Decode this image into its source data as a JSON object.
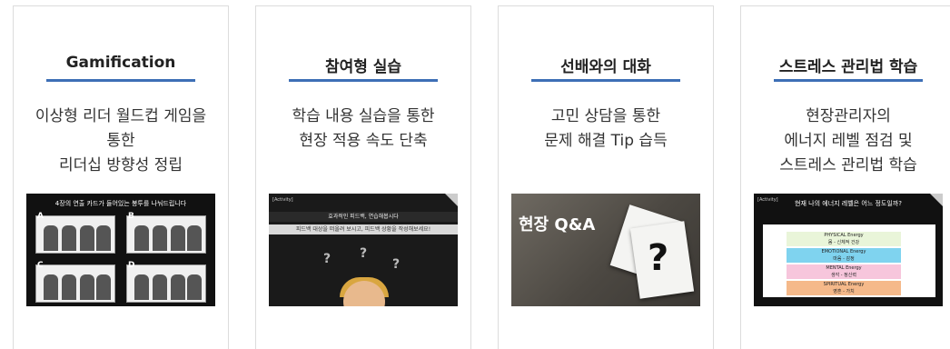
{
  "cards": [
    {
      "title": "Gamification",
      "desc": [
        "이상형 리더 월드컵 게임을",
        "통한",
        "리더십 방향성 정립"
      ],
      "thumb": {
        "header": "4장의 연출 카드가 들어있는 봉투를 나눠드립니다",
        "labels": [
          "A",
          "B",
          "C",
          "D"
        ]
      }
    },
    {
      "title": "참여형 실습",
      "desc": [
        "학습 내용 실습을 통한",
        "현장 적용 속도 단축"
      ],
      "thumb": {
        "tag": "[Activity]",
        "line1": "효과적인 피드백, 연습해봅시다",
        "line2": "피드백 대상을 떠올려 보시고, 피드백 상황을 작성해보세요!"
      }
    },
    {
      "title": "선배와의 대화",
      "desc": [
        "고민 상담을 통한",
        "문제 해결 Tip 습득"
      ],
      "thumb": {
        "caption": "현장 Q&A",
        "mark": "?"
      }
    },
    {
      "title": "스트레스 관리법 학습",
      "desc": [
        "현장관리자의",
        "에너지 레벨 점검 및",
        "스트레스 관리법 학습"
      ],
      "thumb": {
        "tag": "[Activity]",
        "header": "현재 나의 에너지 레벨은 어느 정도일까?",
        "rows": [
          {
            "label": "PHYSICAL Energy",
            "sub": "몸 - 신체적 건강",
            "color": "#e9f5d9"
          },
          {
            "label": "EMOTIONAL Energy",
            "sub": "마음 - 감정",
            "color": "#7fd3ef"
          },
          {
            "label": "MENTAL Energy",
            "sub": "생각 - 정신력",
            "color": "#f7c6dc"
          },
          {
            "label": "SPIRITUAL Energy",
            "sub": "영혼 - 가치",
            "color": "#f5b98a"
          }
        ]
      }
    }
  ],
  "accent": "#3d6fb6"
}
